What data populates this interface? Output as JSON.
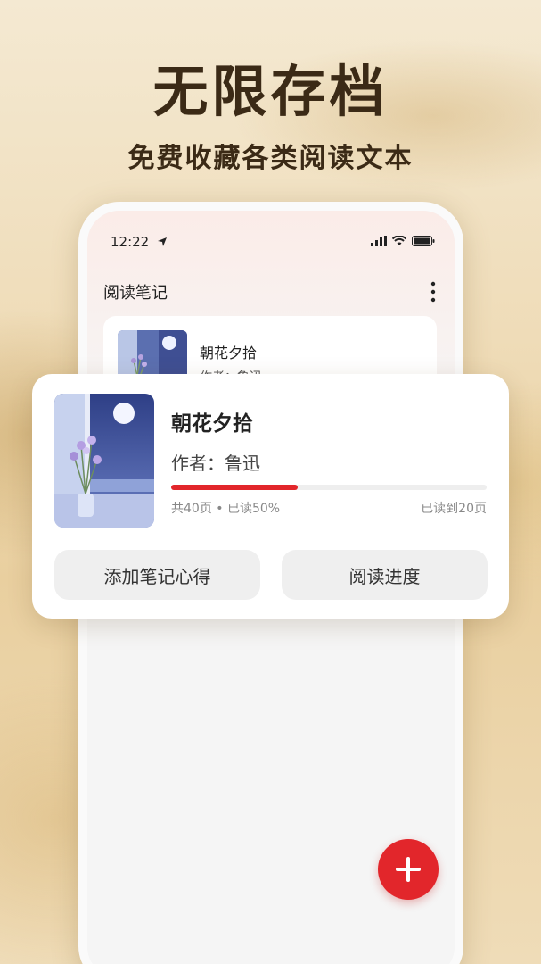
{
  "promo": {
    "headline": "无限存档",
    "subline": "免费收藏各类阅读文本"
  },
  "status_bar": {
    "time": "12:22",
    "icons": [
      "location-arrow-icon",
      "signal-icon",
      "wifi-icon",
      "battery-icon"
    ]
  },
  "app": {
    "title": "阅读笔记",
    "menu_icon": "more-vertical-icon"
  },
  "list": {
    "items": [
      {
        "title": "朝花夕拾",
        "author": "作者：鲁迅"
      }
    ]
  },
  "popup": {
    "title": "朝花夕拾",
    "author": "作者：鲁迅",
    "progress": 0.4,
    "stats_left": "共40页 • 已读50%",
    "stats_right": "已读到20页",
    "buttons": {
      "add_notes": "添加笔记心得",
      "reading_progress": "阅读进度"
    }
  },
  "fab": {
    "icon": "plus-icon"
  },
  "colors": {
    "accent": "#e2262b",
    "headline": "#3b2a16"
  }
}
